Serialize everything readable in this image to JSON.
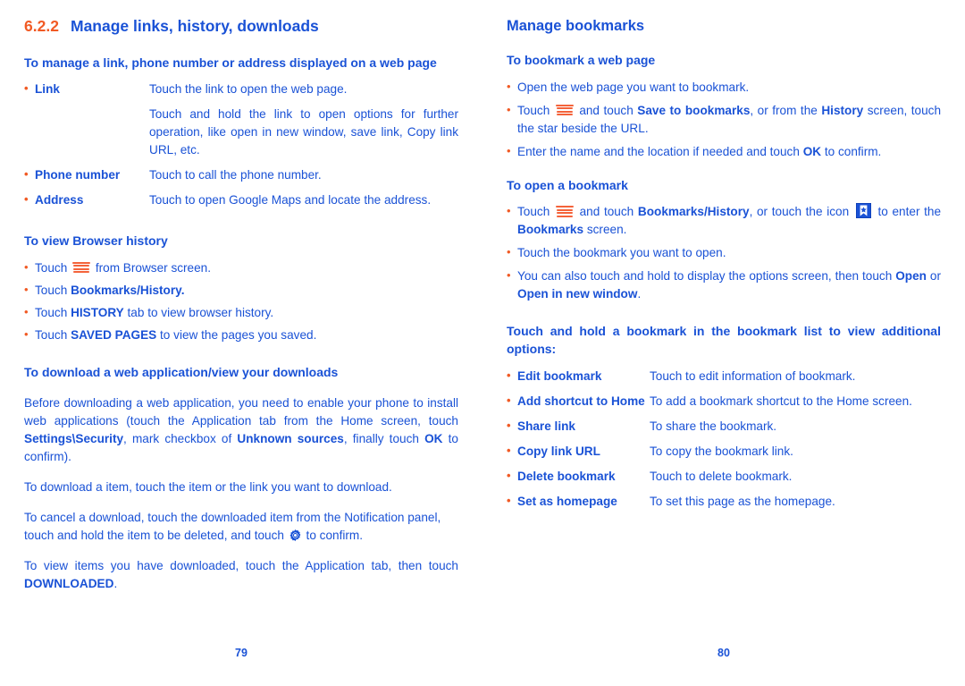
{
  "colors": {
    "text_blue": "#1a52d6",
    "accent_orange": "#f15a24"
  },
  "left_page": {
    "section_number": "6.2.2",
    "section_title": "Manage links, history, downloads",
    "heading_manage": "To manage a link, phone number or address displayed on a web page",
    "link_term": "Link",
    "link_desc_1": "Touch the link to open the web page.",
    "link_desc_2": "Touch and hold the link to open options for further operation, like open in new window, save link, Copy link URL, etc.",
    "phone_term": "Phone number",
    "phone_desc": "Touch to call the phone number.",
    "address_term": "Address",
    "address_desc": "Touch to open Google Maps and locate the address.",
    "heading_history": "To view Browser history",
    "history_b1_pre": "Touch",
    "history_b1_post": "from Browser screen.",
    "history_b2_pre": "Touch",
    "history_b2_bold": "Bookmarks/History.",
    "history_b3_pre": "Touch",
    "history_b3_bold": "HISTORY",
    "history_b3_post": "tab to view browser history.",
    "history_b4_pre": "Touch",
    "history_b4_bold": "SAVED PAGES",
    "history_b4_post": "to view the pages you saved.",
    "heading_download": "To download a web application/view your downloads",
    "download_p1_a": "Before downloading a web application, you need to enable your phone to install web applications (touch the Application tab from the Home screen, touch",
    "download_p1_b1": "Settings\\Security",
    "download_p1_b": ", mark checkbox of",
    "download_p1_b2": "Unknown sources",
    "download_p1_c": ", finally touch",
    "download_p1_b3": "OK",
    "download_p1_d": "to confirm).",
    "download_p2": "To download a item, touch the item or the link you want to download.",
    "download_p3_a": "To cancel a download, touch the downloaded item from the Notification panel, touch and hold the item to be deleted, and touch",
    "download_p3_b": "to confirm.",
    "download_p4_a": "To view items you have downloaded, touch the Application tab, then touch",
    "download_p4_bold": "DOWNLOADED",
    "download_p4_b": ".",
    "page_number": "79"
  },
  "right_page": {
    "heading_bookmarks": "Manage bookmarks",
    "heading_tobookmark": "To bookmark a web page",
    "tb_b1": "Open the web page you want to bookmark.",
    "tb_b2_pre": "Touch",
    "tb_b2_mid": "and touch",
    "tb_b2_bold1": "Save to bookmarks",
    "tb_b2_post": ", or from the",
    "tb_b2_bold2": "History",
    "tb_b2_end": "screen, touch the star beside the URL.",
    "tb_b3_a": "Enter the name and the location if needed and touch",
    "tb_b3_bold": "OK",
    "tb_b3_b": "to confirm.",
    "heading_openbookmark": "To open a bookmark",
    "ob_b1_pre": "Touch",
    "ob_b1_mid": "and touch",
    "ob_b1_bold1": "Bookmarks/History",
    "ob_b1_post": ", or touch the icon",
    "ob_b1_to": "to enter the",
    "ob_b1_bold2": "Bookmarks",
    "ob_b1_end": "screen.",
    "ob_b2": "Touch the bookmark you want to open.",
    "ob_b3_a": "You can also touch and hold to display the options screen, then touch",
    "ob_b3_bold1": "Open",
    "ob_b3_or": "or",
    "ob_b3_bold2": "Open in new window",
    "ob_b3_end": ".",
    "heading_additional": "Touch and hold a bookmark in the bookmark list to view additional options:",
    "options": [
      {
        "term": "Edit bookmark",
        "desc": "Touch to edit information of bookmark."
      },
      {
        "term": "Add shortcut to Home",
        "desc": "To add a bookmark shortcut to the Home screen."
      },
      {
        "term": "Share link",
        "desc": "To share the bookmark."
      },
      {
        "term": "Copy link URL",
        "desc": "To copy the bookmark link."
      },
      {
        "term": "Delete bookmark",
        "desc": "Touch to delete bookmark."
      },
      {
        "term": "Set as homepage",
        "desc": "To set this page as the homepage."
      }
    ],
    "page_number": "80"
  },
  "icons": {
    "menu": "menu-icon",
    "gear": "gear-icon",
    "bookmark": "bookmark-icon"
  }
}
